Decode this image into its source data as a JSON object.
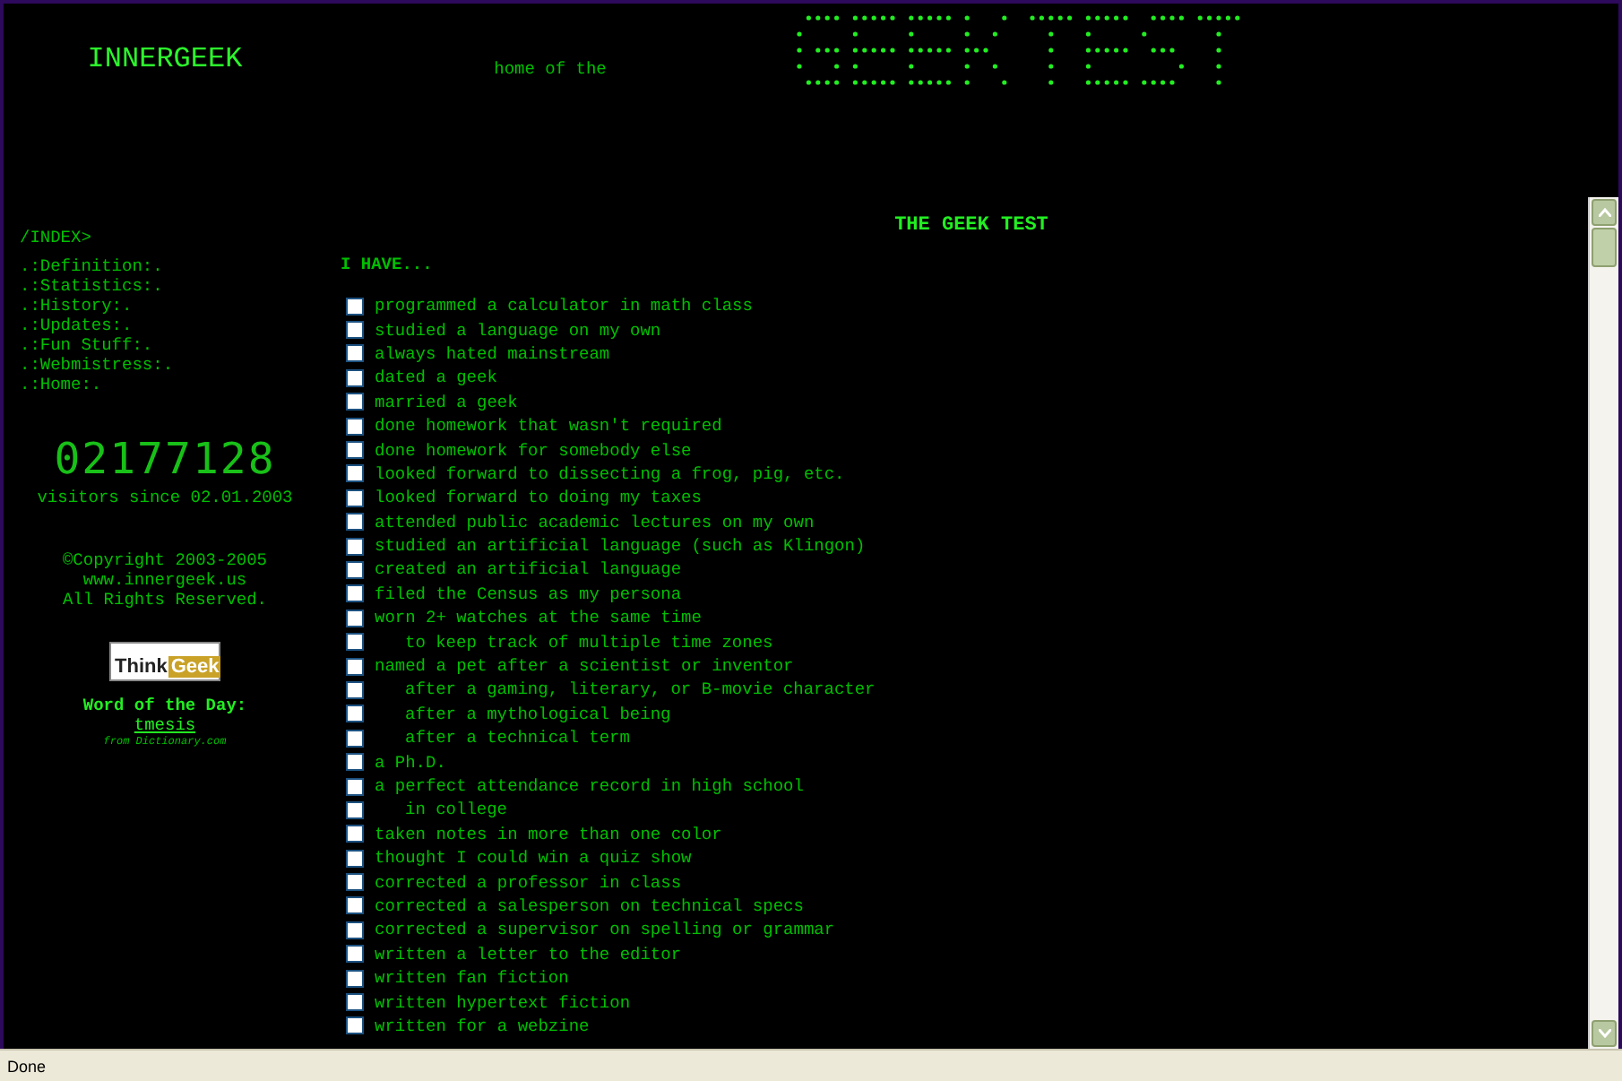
{
  "header": {
    "site_name": "INNERGEEK",
    "tagline": "home of the"
  },
  "sidebar": {
    "index_label": "/INDEX>",
    "links": [
      ".:Definition:.",
      ".:Statistics:.",
      ".:History:.",
      ".:Updates:.",
      ".:Fun Stuff:.",
      ".:Webmistress:.",
      ".:Home:."
    ],
    "counter": "02177128",
    "counter_caption": "visitors since 02.01.2003",
    "copyright": [
      "©Copyright 2003-2005",
      "www.innergeek.us",
      "All Rights Reserved."
    ],
    "logo": {
      "left": "Think",
      "right": "Geek"
    },
    "word_of_day": {
      "label": "Word of the Day:",
      "word": "tmesis",
      "source": "from Dictionary.com"
    }
  },
  "main": {
    "title": "THE GEEK TEST",
    "intro": "I HAVE...",
    "items": [
      {
        "label": "programmed a calculator in math class",
        "checked": false
      },
      {
        "label": "studied a language on my own",
        "checked": false
      },
      {
        "label": "always hated mainstream",
        "checked": false
      },
      {
        "label": "dated a geek",
        "checked": false
      },
      {
        "label": "married a geek",
        "checked": false
      },
      {
        "label": "done homework that wasn't required",
        "checked": false
      },
      {
        "label": "done homework for somebody else",
        "checked": false
      },
      {
        "label": "looked forward to dissecting a frog, pig, etc.",
        "checked": false
      },
      {
        "label": "looked forward to doing my taxes",
        "checked": false
      },
      {
        "label": "attended public academic lectures on my own",
        "checked": false
      },
      {
        "label": "studied an artificial language (such as Klingon)",
        "checked": false
      },
      {
        "label": "created an artificial language",
        "checked": false
      },
      {
        "label": "filed the Census as my persona",
        "checked": false
      },
      {
        "label": "worn 2+ watches at the same time",
        "checked": false,
        "children": [
          {
            "label": "to keep track of multiple time zones",
            "checked": false
          }
        ]
      },
      {
        "label": "named a pet after a scientist or inventor",
        "checked": false,
        "children": [
          {
            "label": "after a gaming, literary, or B-movie character",
            "checked": false
          },
          {
            "label": "after a mythological being",
            "checked": false
          },
          {
            "label": "after a technical term",
            "checked": false
          }
        ]
      },
      {
        "label": "a Ph.D.",
        "checked": false
      },
      {
        "label": "a perfect attendance record in high school",
        "checked": false,
        "children": [
          {
            "label": "in college",
            "checked": false
          }
        ]
      },
      {
        "label": "taken notes in more than one color",
        "checked": false
      },
      {
        "label": "thought I could win a quiz show",
        "checked": false
      },
      {
        "label": "corrected a professor in class",
        "checked": false
      },
      {
        "label": "corrected a salesperson on technical specs",
        "checked": false
      },
      {
        "label": "corrected a supervisor on spelling or grammar",
        "checked": false
      },
      {
        "label": "written a letter to the editor",
        "checked": false
      },
      {
        "label": "written fan fiction",
        "checked": false
      },
      {
        "label": "written hypertext fiction",
        "checked": false
      },
      {
        "label": "written for a webzine",
        "checked": false
      }
    ]
  },
  "status_bar": {
    "text": "Done"
  }
}
